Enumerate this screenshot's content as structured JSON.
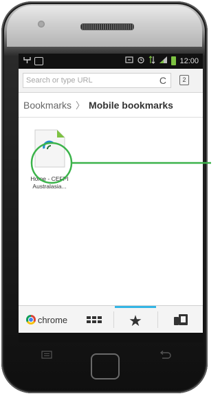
{
  "status_bar": {
    "time": "12:00"
  },
  "omnibox": {
    "placeholder": "Search or type URL",
    "tab_count": "2"
  },
  "breadcrumb": {
    "parent": "Bookmarks",
    "separator": "〉",
    "current": "Mobile bookmarks"
  },
  "bookmarks": [
    {
      "title": "Home - CEFPI Australasia..."
    }
  ],
  "bottom_bar": {
    "brand_label": "chrome",
    "selected_tab": "bookmarks"
  },
  "colors": {
    "accent_blue": "#33b5e5",
    "callout_green": "#3bb34a"
  },
  "icons": [
    "usb-icon",
    "image-icon",
    "sync-icon",
    "alarm-icon",
    "data-arrows-icon",
    "signal-icon",
    "battery-icon",
    "reload-icon",
    "tabs-icon",
    "chrome-logo-icon",
    "most-visited-grid-icon",
    "star-icon",
    "other-devices-icon",
    "menu-key-icon",
    "home-key-icon",
    "back-key-icon"
  ]
}
